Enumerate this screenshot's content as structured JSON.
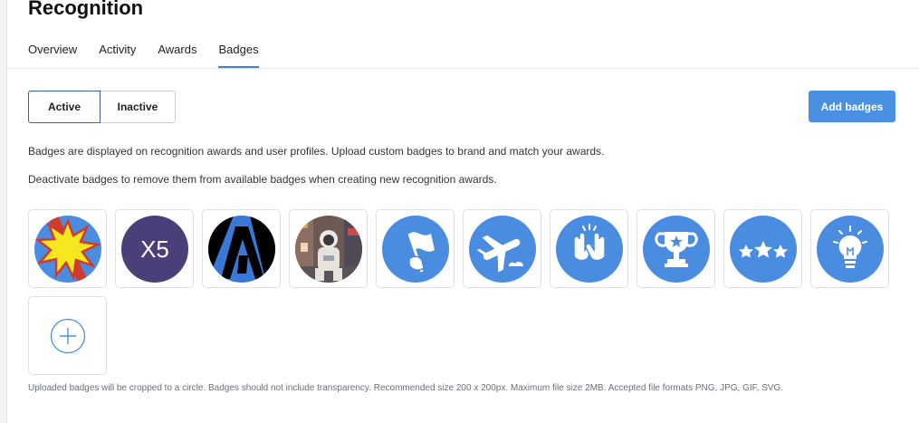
{
  "page": {
    "title": "Recognition"
  },
  "tabs": [
    {
      "label": "Overview"
    },
    {
      "label": "Activity"
    },
    {
      "label": "Awards"
    },
    {
      "label": "Badges",
      "active": true
    }
  ],
  "toggle": {
    "active_label": "Active",
    "inactive_label": "Inactive"
  },
  "add_button": {
    "label": "Add badges"
  },
  "descriptions": {
    "line1": "Badges are displayed on recognition awards and user profiles. Upload custom badges to brand and match your awards.",
    "line2": "Deactivate badges to remove them from available badges when creating new recognition awards."
  },
  "badges": [
    {
      "icon": "starburst-badge-icon"
    },
    {
      "icon": "x5-badge-icon",
      "text": "X5"
    },
    {
      "icon": "a-logo-badge-icon"
    },
    {
      "icon": "astronaut-photo-badge-icon"
    },
    {
      "icon": "flag-badge-icon"
    },
    {
      "icon": "airplane-badge-icon"
    },
    {
      "icon": "high-five-badge-icon"
    },
    {
      "icon": "trophy-badge-icon"
    },
    {
      "icon": "three-stars-badge-icon"
    },
    {
      "icon": "lightbulb-badge-icon"
    }
  ],
  "add_tile": {
    "icon": "plus-icon"
  },
  "footer_note": "Uploaded badges will be cropped to a circle. Badges should not include transparency. Recommended size 200 x 200px. Maximum file size 2MB. Accepted file formats PNG, JPG, GIF, SVG.",
  "colors": {
    "accent": "#4a90e2",
    "badge_blue": "#4a8de0",
    "x5_purple": "#4a3f79"
  }
}
